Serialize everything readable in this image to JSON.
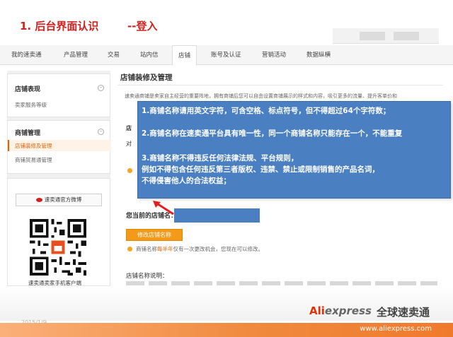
{
  "slide": {
    "title": "1. 后台界面认识",
    "subtitle": "--登入"
  },
  "nav": {
    "items": [
      "我的速卖通",
      "产品管理",
      "交易",
      "站内信",
      "店铺",
      "账号及认证",
      "营销活动",
      "数据纵横"
    ],
    "active": "店铺"
  },
  "sidebar": {
    "sections": [
      {
        "heading": "店铺表现",
        "links": [
          "卖家服务等级"
        ]
      },
      {
        "heading": "商铺管理",
        "links": [
          "店铺装修及管理",
          "商铺贸易通管理"
        ],
        "active": "店铺装修及管理"
      }
    ],
    "weibo_button": "速卖通官方微博",
    "qr_caption": "速卖通卖家手机客户端"
  },
  "main": {
    "title": "店铺装修及管理",
    "description": "速卖通商铺是卖家自主经营的重要阵地，拥有商铺后您可以自由设置商铺展示的样式和内容，吸引更多的流量、提升客单价和",
    "fragment_1": "店",
    "fragment_2": "对",
    "current_name_label": "您当前的店铺名：",
    "edit_button": "修改店铺名称",
    "tip_prefix": "商铺名称",
    "tip_highlight": "每半年",
    "tip_suffix": "仅有一次更改机会，您现在可以修改。",
    "explain_label": "店铺名称说明："
  },
  "callout": {
    "lines": [
      "1.商铺名称请用英文字符，可含空格、标点符号，但不得超过64个字符数；",
      "2.商铺名称在速卖通平台具有唯一性，同一个商铺名称只能存在一个，不能重复",
      "3.商铺名称不得违反任何法律法规、平台规则，",
      "例如不得包含任何违反第三者版权、违禁、禁止或限制销售的产品名词，",
      "不得侵害他人的合法权益；"
    ]
  },
  "footer": {
    "date": "2015/1/9",
    "logo_ali": "Ali",
    "logo_express": "express",
    "logo_cn": "全球速卖通",
    "url": "www.aliexpress.com"
  },
  "colors": {
    "title_red": "#d2211e",
    "accent_orange": "#e86000",
    "button_orange": "#f39a1b",
    "callout_blue": "#4a7fc2"
  }
}
